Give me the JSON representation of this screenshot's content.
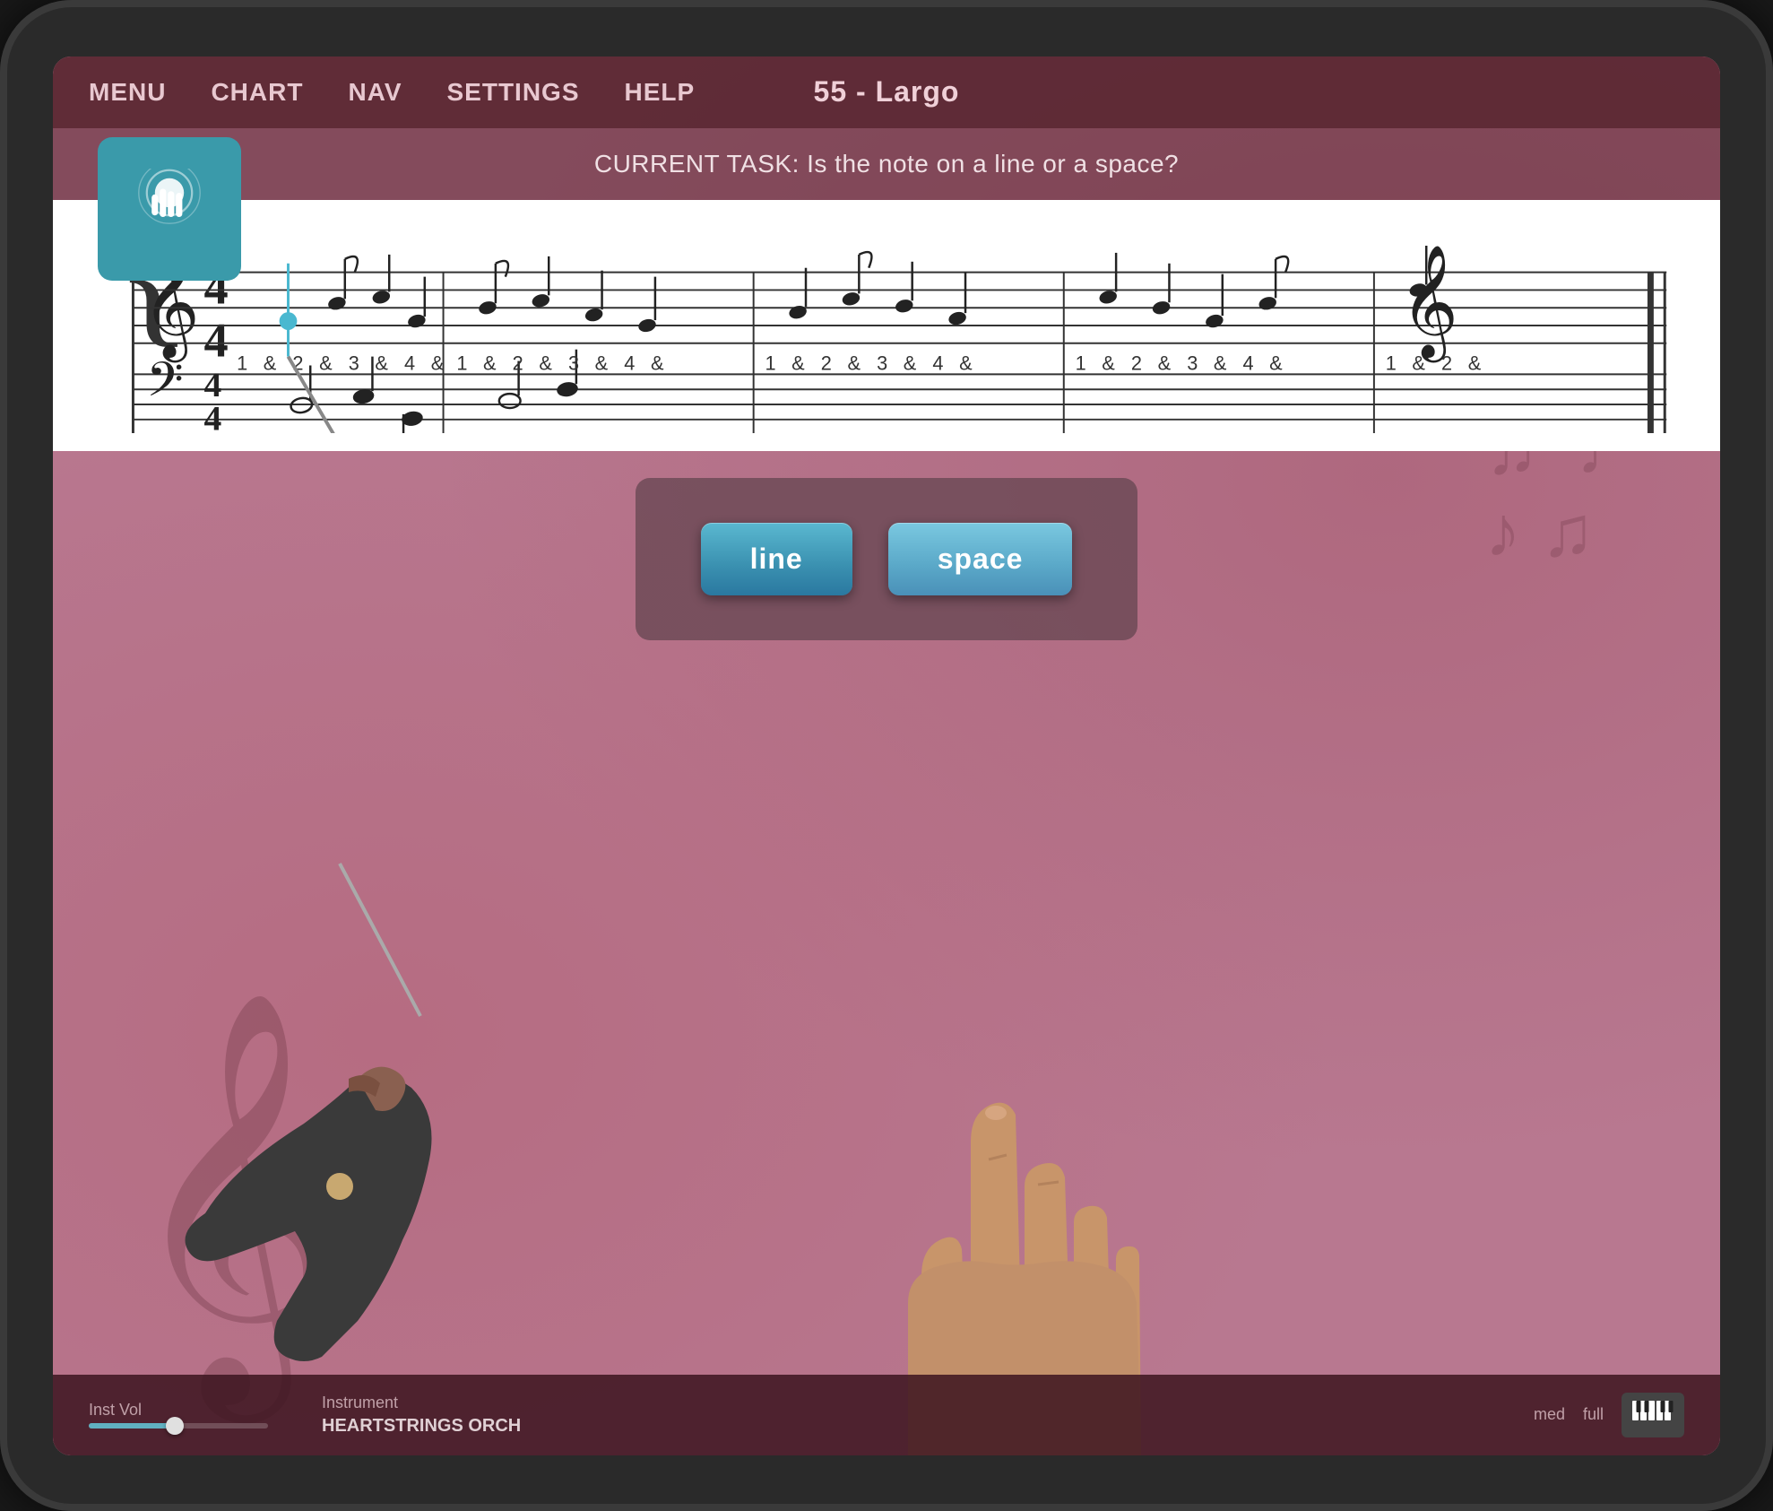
{
  "app": {
    "title": "55 - Largo",
    "current_task": "CURRENT TASK: Is the note on a line or a space?"
  },
  "nav": {
    "items": [
      {
        "label": "MENU",
        "id": "menu"
      },
      {
        "label": "CHART",
        "id": "chart"
      },
      {
        "label": "NAV",
        "id": "nav"
      },
      {
        "label": "SETTINGS",
        "id": "settings"
      },
      {
        "label": "HELP",
        "id": "help"
      }
    ]
  },
  "touch_icon": {
    "label": "touch icon"
  },
  "answer_buttons": {
    "line_label": "line",
    "space_label": "space"
  },
  "bottom_controls": {
    "inst_vol_label": "Inst Vol",
    "instrument_label": "Instrument",
    "instrument_name": "HEARTSTRINGS ORCH",
    "volume_low": "med",
    "volume_high": "full"
  },
  "staff": {
    "beat_labels": [
      "1",
      "&",
      "2",
      "&",
      "3",
      "&",
      "4",
      "&"
    ],
    "clef_top": "𝄞",
    "clef_bottom": "𝄢",
    "time_sig": "4/4"
  }
}
